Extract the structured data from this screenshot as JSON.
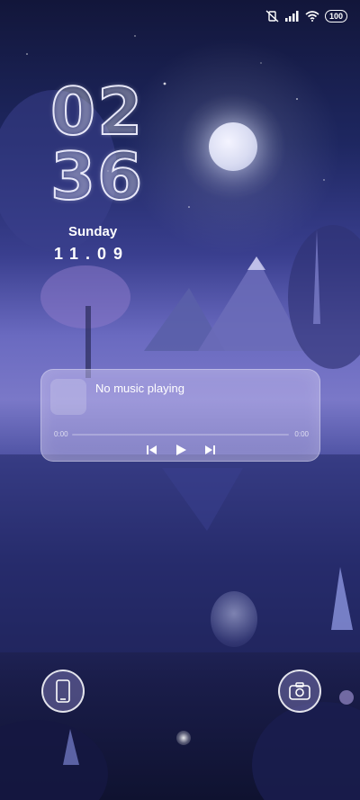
{
  "status_bar": {
    "battery": "100",
    "icons": [
      "mute-vibrate-icon",
      "signal-icon",
      "wifi-icon",
      "battery-icon"
    ]
  },
  "lock_screen": {
    "clock": {
      "hours": "02",
      "minutes": "36"
    },
    "day": "Sunday",
    "date": "11.09"
  },
  "music_widget": {
    "title": "No music playing",
    "time_start": "0:00",
    "time_end": "0:00",
    "controls": [
      "previous-icon",
      "play-icon",
      "next-icon"
    ]
  },
  "shortcuts": {
    "left": "phone-icon",
    "right": "camera-icon"
  },
  "colors": {
    "accent": "#7a78c8",
    "widget": "#c8beF0"
  }
}
